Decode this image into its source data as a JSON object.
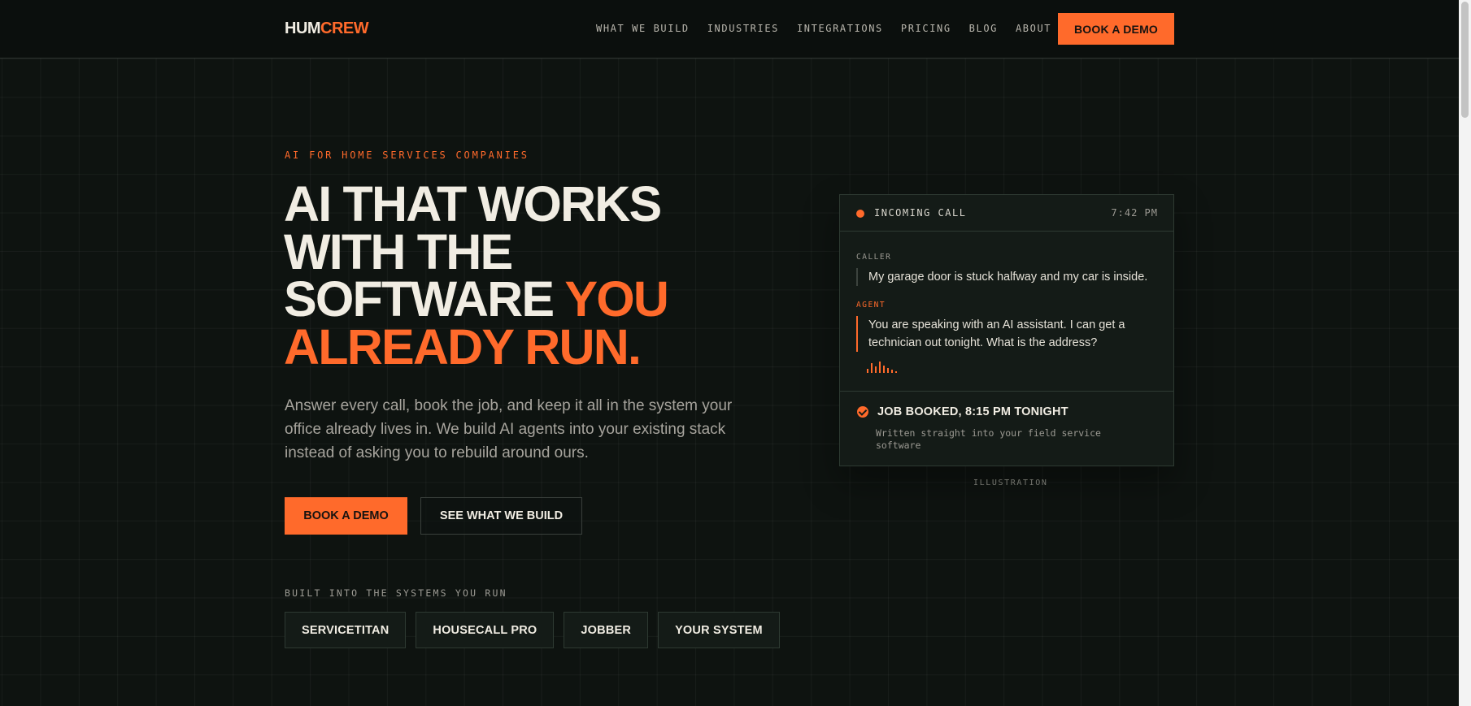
{
  "nav": {
    "logo_part1": "HUM",
    "logo_part2": "CREW",
    "links": [
      "WHAT WE BUILD",
      "INDUSTRIES",
      "INTEGRATIONS",
      "PRICING",
      "BLOG",
      "ABOUT"
    ],
    "cta_label": "BOOK A DEMO"
  },
  "hero": {
    "eyebrow": "AI FOR HOME SERVICES COMPANIES",
    "headline": {
      "line1": "AI THAT WORKS",
      "line2": "WITH THE",
      "line3_plain": "SOFTWARE ",
      "line3_accent": "YOU",
      "line4_accent": "ALREADY RUN."
    },
    "lede": "Answer every call, book the job, and keep it all in the system your office already lives in. We build AI agents into your existing stack instead of asking you to rebuild around ours.",
    "primary_button": "BOOK A DEMO",
    "secondary_button": "SEE WHAT WE BUILD",
    "built_label": "BUILT INTO THE SYSTEMS YOU RUN",
    "integrations": [
      "SERVICETITAN",
      "HOUSECALL PRO",
      "JOBBER",
      "YOUR SYSTEM"
    ]
  },
  "call_card": {
    "status": "INCOMING CALL",
    "time": "7:42 PM",
    "caller_label": "CALLER",
    "caller_text": "My garage door is stuck halfway and my car is inside.",
    "agent_label": "AGENT",
    "agent_text": "You are speaking with an AI assistant. I can get a technician out tonight. What is the address?",
    "booked_title": "JOB BOOKED, 8:15 PM TONIGHT",
    "booked_note": "Written straight into your field service software",
    "caption": "ILLUSTRATION"
  },
  "colors": {
    "accent": "#ff6a2b",
    "background": "#0e1310",
    "card": "#141b17",
    "text": "#f1ede3"
  },
  "icons": {
    "status_dot": "status-dot-icon",
    "waveform": "waveform-icon",
    "check": "check-circle-icon"
  }
}
